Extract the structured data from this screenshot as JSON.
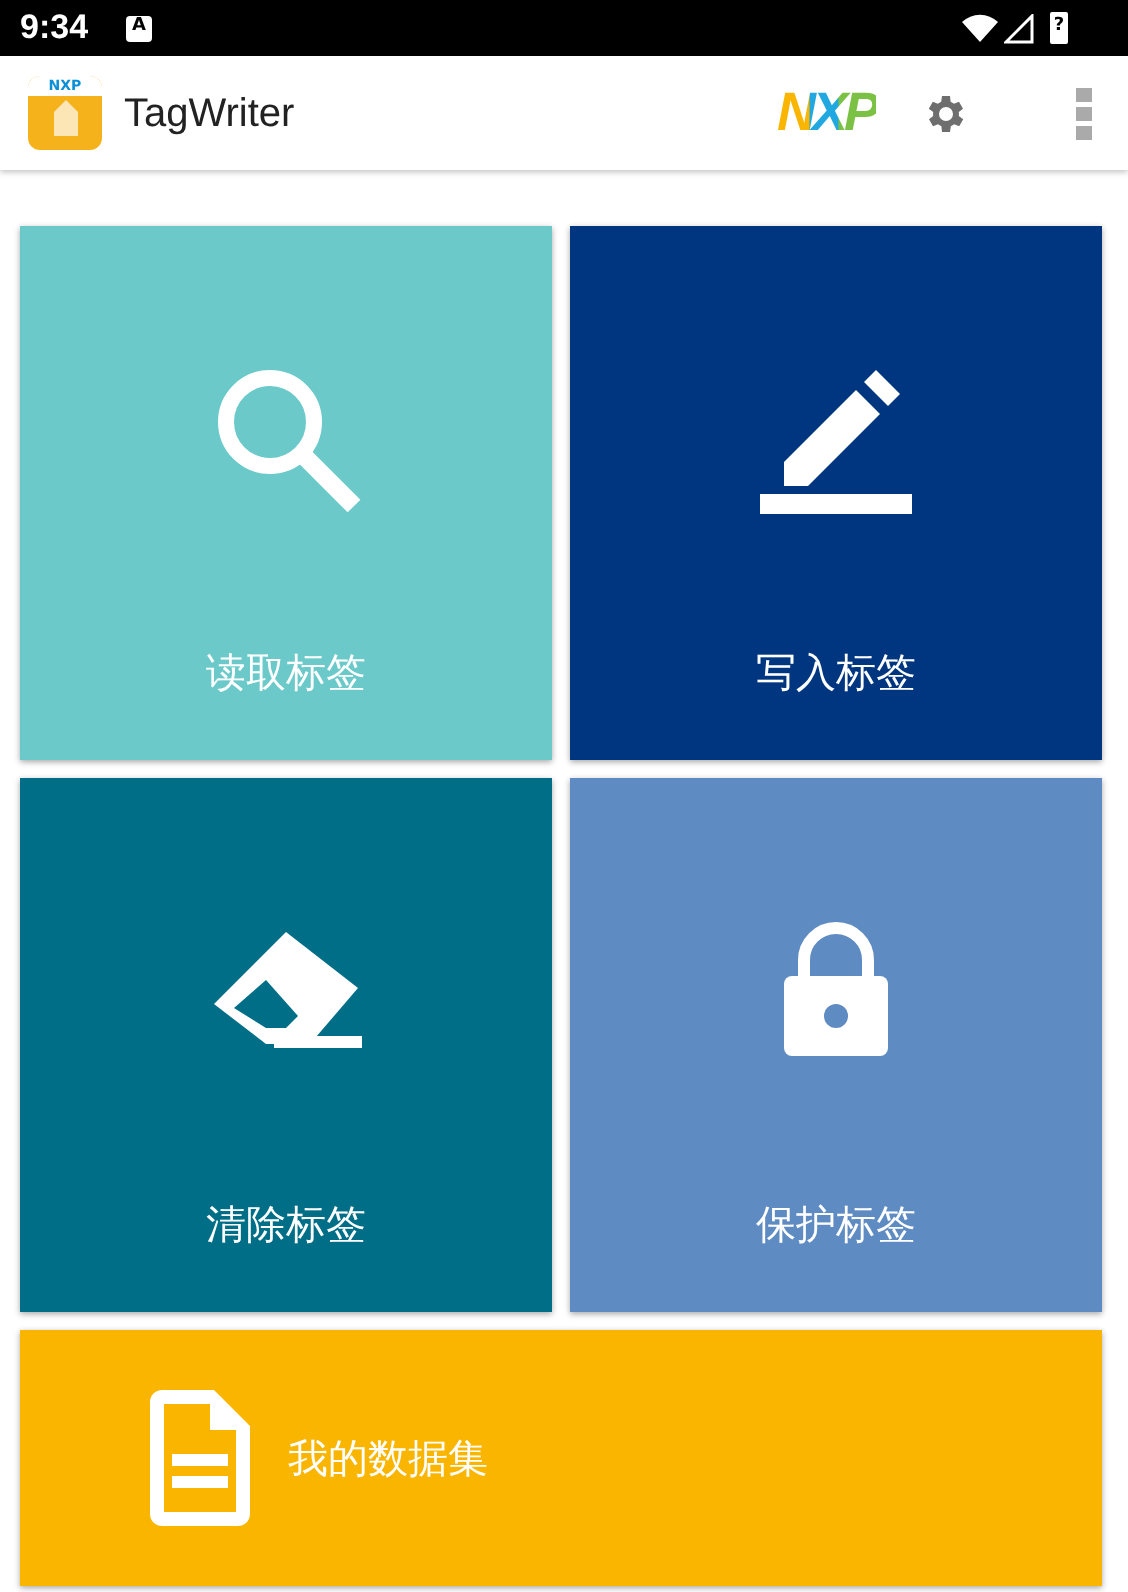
{
  "status_bar": {
    "time": "9:34",
    "notification": "A",
    "battery": "?"
  },
  "app_bar": {
    "app_icon_text": "NXP",
    "title": "TagWriter",
    "brand": "NXP"
  },
  "tiles": [
    {
      "kind": "search",
      "label": "读取标签",
      "color": "#6bc9ca"
    },
    {
      "kind": "edit",
      "label": "写入标签",
      "color": "#003680"
    },
    {
      "kind": "eraser",
      "label": "清除标签",
      "color": "#006e87"
    },
    {
      "kind": "lock",
      "label": "保护标签",
      "color": "#5f8bc3"
    }
  ],
  "wide_tile": {
    "kind": "document",
    "label": "我的数据集",
    "color": "#f9b500"
  }
}
